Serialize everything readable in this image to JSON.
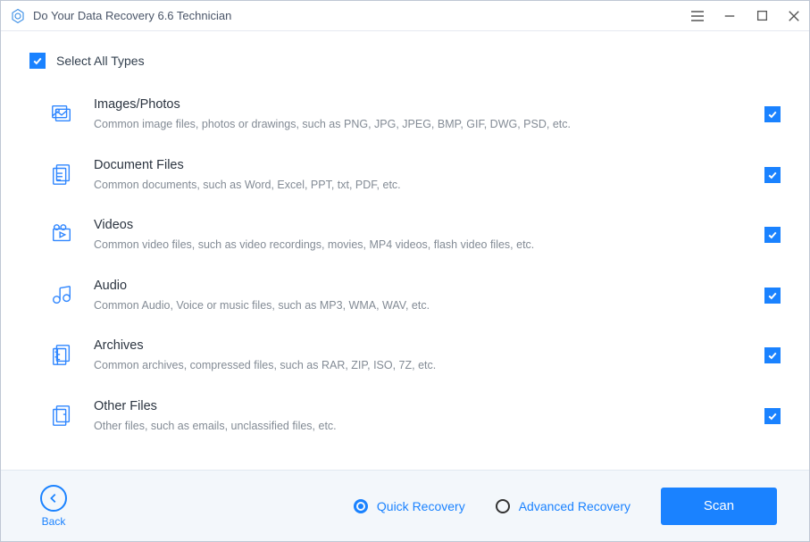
{
  "titlebar": {
    "title": "Do Your Data Recovery 6.6 Technician"
  },
  "select_all": {
    "label": "Select All Types",
    "checked": true
  },
  "types": [
    {
      "title": "Images/Photos",
      "desc": "Common image files, photos or drawings, such as PNG, JPG, JPEG, BMP, GIF, DWG, PSD, etc.",
      "icon": "image-icon",
      "checked": true
    },
    {
      "title": "Document Files",
      "desc": "Common documents, such as Word, Excel, PPT, txt, PDF, etc.",
      "icon": "document-icon",
      "checked": true
    },
    {
      "title": "Videos",
      "desc": "Common video files, such as video recordings, movies, MP4 videos, flash video files, etc.",
      "icon": "video-icon",
      "checked": true
    },
    {
      "title": "Audio",
      "desc": "Common Audio, Voice or music files, such as MP3, WMA, WAV, etc.",
      "icon": "audio-icon",
      "checked": true
    },
    {
      "title": "Archives",
      "desc": "Common archives, compressed files, such as RAR, ZIP, ISO, 7Z, etc.",
      "icon": "archive-icon",
      "checked": true
    },
    {
      "title": "Other Files",
      "desc": "Other files, such as emails, unclassified files, etc.",
      "icon": "other-icon",
      "checked": true
    }
  ],
  "footer": {
    "back_label": "Back",
    "quick_label": "Quick Recovery",
    "advanced_label": "Advanced Recovery",
    "scan_label": "Scan",
    "mode_selected": "quick"
  }
}
